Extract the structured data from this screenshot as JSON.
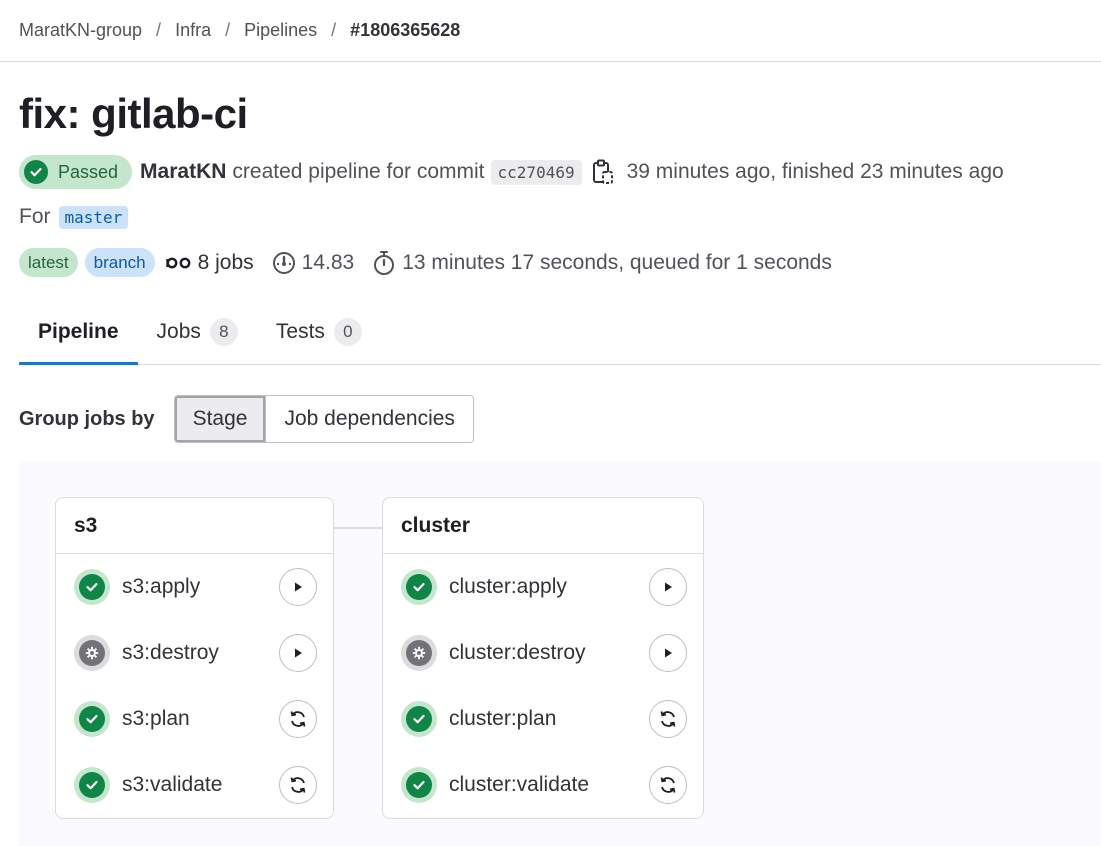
{
  "breadcrumb": {
    "items": [
      "MaratKN-group",
      "Infra",
      "Pipelines"
    ],
    "separator": "/",
    "current": "#1806365628"
  },
  "pipeline": {
    "title": "fix: gitlab-ci",
    "status": "Passed",
    "author": "MaratKN",
    "created_text": "created pipeline for commit",
    "commit_sha": "cc270469",
    "time_text": "39 minutes ago, finished 23 minutes ago",
    "for_label": "For",
    "ref": "master",
    "badges": [
      "latest",
      "branch"
    ],
    "jobs_count": "8 jobs",
    "compute": "14.83",
    "duration": "13 minutes 17 seconds, queued for 1 seconds"
  },
  "tabs": [
    {
      "label": "Pipeline",
      "count": null
    },
    {
      "label": "Jobs",
      "count": "8"
    },
    {
      "label": "Tests",
      "count": "0"
    }
  ],
  "group_by": {
    "label": "Group jobs by",
    "options": [
      "Stage",
      "Job dependencies"
    ],
    "selected": "Stage"
  },
  "stages": [
    {
      "name": "s3",
      "jobs": [
        {
          "name": "s3:apply",
          "status": "success",
          "action": "play"
        },
        {
          "name": "s3:destroy",
          "status": "manual",
          "action": "play"
        },
        {
          "name": "s3:plan",
          "status": "success",
          "action": "retry"
        },
        {
          "name": "s3:validate",
          "status": "success",
          "action": "retry"
        }
      ]
    },
    {
      "name": "cluster",
      "jobs": [
        {
          "name": "cluster:apply",
          "status": "success",
          "action": "play"
        },
        {
          "name": "cluster:destroy",
          "status": "manual",
          "action": "play"
        },
        {
          "name": "cluster:plan",
          "status": "success",
          "action": "retry"
        },
        {
          "name": "cluster:validate",
          "status": "success",
          "action": "retry"
        }
      ]
    }
  ],
  "colors": {
    "success": "#108548",
    "success_bg": "#c3e6cd",
    "accent": "#1f75cb",
    "manual": "#737278"
  }
}
